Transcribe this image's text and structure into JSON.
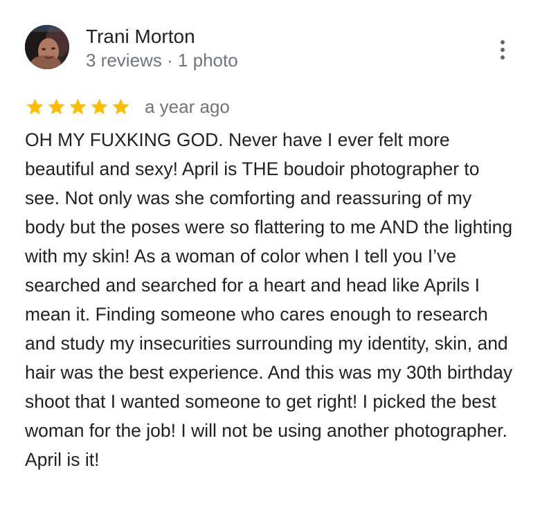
{
  "review": {
    "author": {
      "name": "Trani Morton",
      "meta": "3 reviews · 1 photo"
    },
    "rating": 5,
    "max_rating": 5,
    "star_color": "#fbbc04",
    "date": "a year ago",
    "text": "OH MY FUXKING GOD. Never have I ever felt more beautiful and sexy! April is THE boudoir photographer to see. Not only was she comforting and reassuring of my body but the poses were so flattering to me AND the lighting with my skin! As a woman of color when I tell you I’ve searched and searched for a heart and head like Aprils I mean it. Finding someone who cares enough to research and study my insecurities surrounding my identity, skin, and hair was the best experience. And this was my 30th birthday shoot that I wanted someone to get right! I picked the best woman for the job! I will not be using another photographer. April is it!"
  },
  "icons": {
    "more": "more-vert-icon",
    "star": "star-icon"
  }
}
